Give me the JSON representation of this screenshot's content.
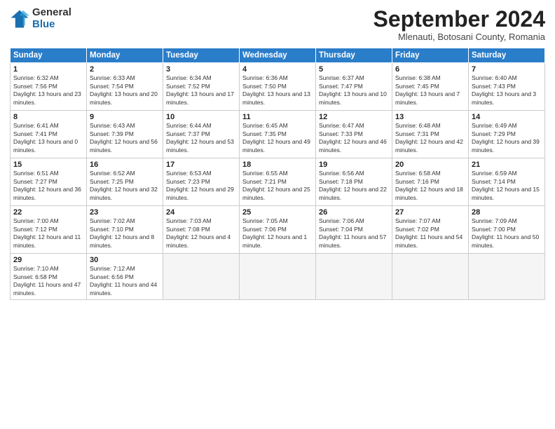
{
  "logo": {
    "general": "General",
    "blue": "Blue"
  },
  "title": "September 2024",
  "subtitle": "Mlenauti, Botosani County, Romania",
  "days_header": [
    "Sunday",
    "Monday",
    "Tuesday",
    "Wednesday",
    "Thursday",
    "Friday",
    "Saturday"
  ],
  "weeks": [
    [
      {
        "day": "1",
        "sunrise": "6:32 AM",
        "sunset": "7:56 PM",
        "daylight": "13 hours and 23 minutes."
      },
      {
        "day": "2",
        "sunrise": "6:33 AM",
        "sunset": "7:54 PM",
        "daylight": "13 hours and 20 minutes."
      },
      {
        "day": "3",
        "sunrise": "6:34 AM",
        "sunset": "7:52 PM",
        "daylight": "13 hours and 17 minutes."
      },
      {
        "day": "4",
        "sunrise": "6:36 AM",
        "sunset": "7:50 PM",
        "daylight": "13 hours and 13 minutes."
      },
      {
        "day": "5",
        "sunrise": "6:37 AM",
        "sunset": "7:47 PM",
        "daylight": "13 hours and 10 minutes."
      },
      {
        "day": "6",
        "sunrise": "6:38 AM",
        "sunset": "7:45 PM",
        "daylight": "13 hours and 7 minutes."
      },
      {
        "day": "7",
        "sunrise": "6:40 AM",
        "sunset": "7:43 PM",
        "daylight": "13 hours and 3 minutes."
      }
    ],
    [
      {
        "day": "8",
        "sunrise": "6:41 AM",
        "sunset": "7:41 PM",
        "daylight": "13 hours and 0 minutes."
      },
      {
        "day": "9",
        "sunrise": "6:43 AM",
        "sunset": "7:39 PM",
        "daylight": "12 hours and 56 minutes."
      },
      {
        "day": "10",
        "sunrise": "6:44 AM",
        "sunset": "7:37 PM",
        "daylight": "12 hours and 53 minutes."
      },
      {
        "day": "11",
        "sunrise": "6:45 AM",
        "sunset": "7:35 PM",
        "daylight": "12 hours and 49 minutes."
      },
      {
        "day": "12",
        "sunrise": "6:47 AM",
        "sunset": "7:33 PM",
        "daylight": "12 hours and 46 minutes."
      },
      {
        "day": "13",
        "sunrise": "6:48 AM",
        "sunset": "7:31 PM",
        "daylight": "12 hours and 42 minutes."
      },
      {
        "day": "14",
        "sunrise": "6:49 AM",
        "sunset": "7:29 PM",
        "daylight": "12 hours and 39 minutes."
      }
    ],
    [
      {
        "day": "15",
        "sunrise": "6:51 AM",
        "sunset": "7:27 PM",
        "daylight": "12 hours and 36 minutes."
      },
      {
        "day": "16",
        "sunrise": "6:52 AM",
        "sunset": "7:25 PM",
        "daylight": "12 hours and 32 minutes."
      },
      {
        "day": "17",
        "sunrise": "6:53 AM",
        "sunset": "7:23 PM",
        "daylight": "12 hours and 29 minutes."
      },
      {
        "day": "18",
        "sunrise": "6:55 AM",
        "sunset": "7:21 PM",
        "daylight": "12 hours and 25 minutes."
      },
      {
        "day": "19",
        "sunrise": "6:56 AM",
        "sunset": "7:18 PM",
        "daylight": "12 hours and 22 minutes."
      },
      {
        "day": "20",
        "sunrise": "6:58 AM",
        "sunset": "7:16 PM",
        "daylight": "12 hours and 18 minutes."
      },
      {
        "day": "21",
        "sunrise": "6:59 AM",
        "sunset": "7:14 PM",
        "daylight": "12 hours and 15 minutes."
      }
    ],
    [
      {
        "day": "22",
        "sunrise": "7:00 AM",
        "sunset": "7:12 PM",
        "daylight": "12 hours and 11 minutes."
      },
      {
        "day": "23",
        "sunrise": "7:02 AM",
        "sunset": "7:10 PM",
        "daylight": "12 hours and 8 minutes."
      },
      {
        "day": "24",
        "sunrise": "7:03 AM",
        "sunset": "7:08 PM",
        "daylight": "12 hours and 4 minutes."
      },
      {
        "day": "25",
        "sunrise": "7:05 AM",
        "sunset": "7:06 PM",
        "daylight": "12 hours and 1 minute."
      },
      {
        "day": "26",
        "sunrise": "7:06 AM",
        "sunset": "7:04 PM",
        "daylight": "11 hours and 57 minutes."
      },
      {
        "day": "27",
        "sunrise": "7:07 AM",
        "sunset": "7:02 PM",
        "daylight": "11 hours and 54 minutes."
      },
      {
        "day": "28",
        "sunrise": "7:09 AM",
        "sunset": "7:00 PM",
        "daylight": "11 hours and 50 minutes."
      }
    ],
    [
      {
        "day": "29",
        "sunrise": "7:10 AM",
        "sunset": "6:58 PM",
        "daylight": "11 hours and 47 minutes."
      },
      {
        "day": "30",
        "sunrise": "7:12 AM",
        "sunset": "6:56 PM",
        "daylight": "11 hours and 44 minutes."
      },
      null,
      null,
      null,
      null,
      null
    ]
  ]
}
